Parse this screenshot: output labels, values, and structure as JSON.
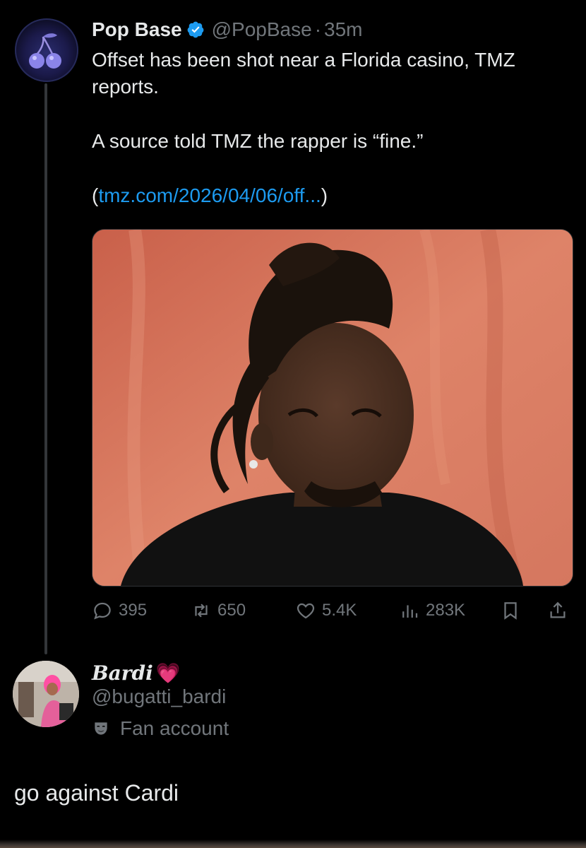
{
  "tweet": {
    "author_name": "Pop Base",
    "handle": "@PopBase",
    "separator": "·",
    "time": "35m",
    "lines": [
      "Offset has been shot near a Florida casino, TMZ reports.",
      "A source told TMZ the rapper is “fine.”"
    ],
    "link_open": "(",
    "link_text": "tmz.com/2026/04/06/off...",
    "link_close": ")",
    "actions": {
      "replies": "395",
      "reposts": "650",
      "likes": "5.4K",
      "views": "283K"
    }
  },
  "reply": {
    "author_name": "Bardi",
    "name_emoji": "💗",
    "handle": "@bugatti_bardi",
    "badge_label": "Fan account",
    "text": "go against Cardi"
  },
  "colors": {
    "background": "#000000",
    "text": "#e7e9ea",
    "secondary": "#71767b",
    "link": "#1d9bf0",
    "verified": "#1d9bf0"
  },
  "icons": [
    "cherries-icon",
    "verified-badge-icon",
    "reply-icon",
    "repost-icon",
    "like-icon",
    "views-icon",
    "bookmark-icon",
    "share-icon",
    "theater-mask-icon"
  ]
}
